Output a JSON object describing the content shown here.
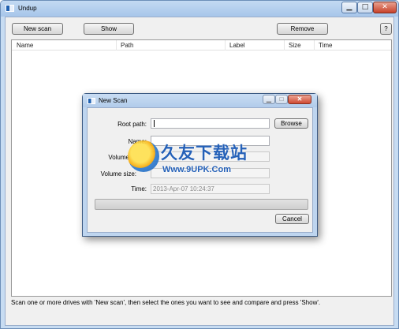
{
  "window": {
    "title": "Undup",
    "controls": {
      "minimize": "▁",
      "maximize": "□",
      "close": "✕"
    }
  },
  "toolbar": {
    "new_scan": "New scan",
    "show": "Show",
    "remove": "Remove",
    "help": "?"
  },
  "list": {
    "columns": [
      "Name",
      "Path",
      "Label",
      "Size",
      "Time"
    ]
  },
  "status_text": "Scan one or more drives with 'New scan', then select the ones you want to see and compare and press 'Show'.",
  "dialog": {
    "title": "New Scan",
    "controls": {
      "minimize": "▁",
      "maximize": "□",
      "close": "✕"
    },
    "root_path_label": "Root path:",
    "root_path_value": "",
    "name_label": "Name:",
    "name_value": "",
    "volume_label": "Volume",
    "volume_size_label": "Volume size:",
    "time_label": "Time:",
    "time_value": "2013-Apr-07 10:24:37",
    "browse": "Browse",
    "cancel": "Cancel",
    "progress": 0
  },
  "watermark": {
    "title": "久友下载站",
    "url": "Www.9UPK.Com"
  },
  "colors": {
    "titlebar": "#a7c6ea",
    "window_bg": "#f0f0f0",
    "close_button": "#c8422a",
    "watermark": "#2561b8"
  }
}
